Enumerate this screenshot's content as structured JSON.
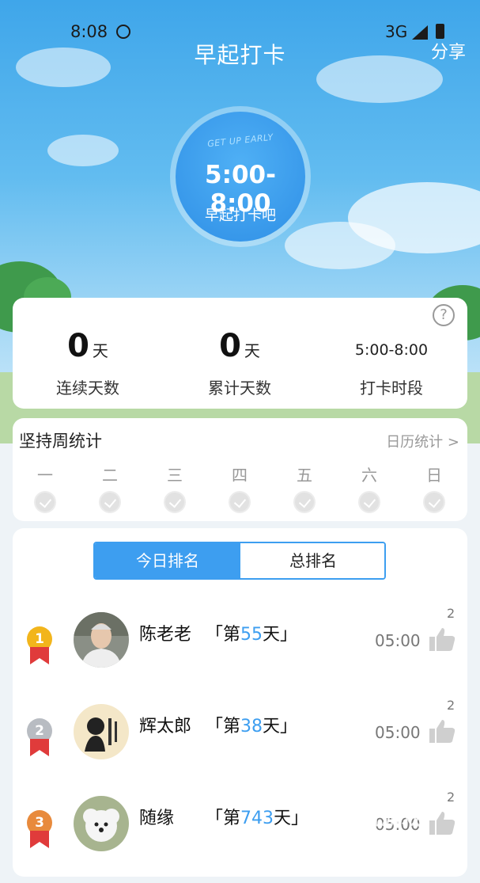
{
  "status_bar": {
    "time": "8:08",
    "network": "3G"
  },
  "header": {
    "title": "早起打卡",
    "share_label": "分享"
  },
  "clock": {
    "brand_text": "GET UP EARLY",
    "time_range": "5:00-8:00",
    "subtitle": "早起打卡吧"
  },
  "stats": [
    {
      "value": "0",
      "unit": "天",
      "label": "连续天数"
    },
    {
      "value": "0",
      "unit": "天",
      "label": "累计天数"
    },
    {
      "value": "5:00-8:00",
      "unit": "",
      "label": "打卡时段"
    }
  ],
  "weekly": {
    "title": "坚持周统计",
    "calendar_link": "日历统计 >",
    "days": [
      "一",
      "二",
      "三",
      "四",
      "五",
      "六",
      "日"
    ]
  },
  "ranking": {
    "tabs": [
      "今日排名",
      "总排名"
    ],
    "active_tab": 0,
    "rows": [
      {
        "rank": "1",
        "name": "陈老老",
        "days_prefix": "「第",
        "days": "55",
        "days_suffix": "天」",
        "time": "05:00",
        "likes": "2",
        "medal_color": "#f2b51c"
      },
      {
        "rank": "2",
        "name": "辉太郎",
        "days_prefix": "「第",
        "days": "38",
        "days_suffix": "天」",
        "time": "05:00",
        "likes": "2",
        "medal_color": "#b8bcc2"
      },
      {
        "rank": "3",
        "name": "随缘",
        "days_prefix": "「第",
        "days": "743",
        "days_suffix": "天」",
        "time": "05:00",
        "likes": "2",
        "medal_color": "#e88a3c"
      }
    ]
  },
  "watermark": {
    "text": "伪玩游戏",
    "subtext": "Henwan Games"
  },
  "colors": {
    "accent": "#3d9ef0",
    "sky_top": "#3fa6ea"
  }
}
